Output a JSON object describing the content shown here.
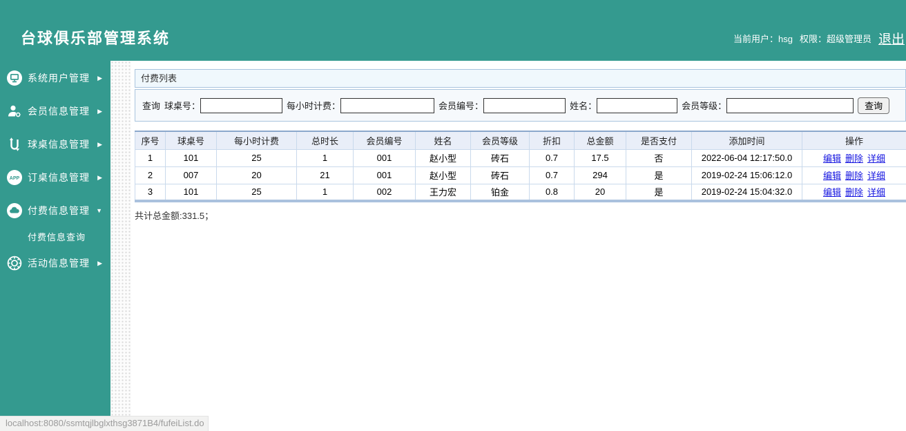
{
  "header": {
    "title": "台球俱乐部管理系统",
    "current_user": "当前用户：hsg",
    "role": "权限：超级管理员",
    "logout_label": "退出"
  },
  "sidebar": {
    "items": [
      {
        "label": "系统用户管理",
        "icon": "monitor-icon",
        "arrow": "▶"
      },
      {
        "label": "会员信息管理",
        "icon": "user-gear-icon",
        "arrow": "▶"
      },
      {
        "label": "球桌信息管理",
        "icon": "u-arrows-icon",
        "arrow": "▶"
      },
      {
        "label": "订桌信息管理",
        "icon": "app-icon",
        "arrow": "▶"
      },
      {
        "label": "付费信息管理",
        "icon": "cloud-icon",
        "arrow": "▼",
        "expanded": true
      },
      {
        "label": "活动信息管理",
        "icon": "gear-icon",
        "arrow": "▶"
      }
    ],
    "submenu": {
      "label": "付费信息查询"
    }
  },
  "main": {
    "panel_title": "付费列表",
    "search": {
      "prefix": "查询",
      "fields": [
        {
          "label": "球桌号：",
          "value": "",
          "placeholder": ""
        },
        {
          "label": "每小时计费：",
          "value": "",
          "placeholder": ""
        },
        {
          "label": "会员编号：",
          "value": "",
          "placeholder": ""
        },
        {
          "label": "姓名：",
          "value": "",
          "placeholder": ""
        },
        {
          "label": "会员等级：",
          "value": "",
          "placeholder": ""
        }
      ],
      "button_label": "查询"
    },
    "table": {
      "headers": [
        "序号",
        "球桌号",
        "每小时计费",
        "总时长",
        "会员编号",
        "姓名",
        "会员等级",
        "折扣",
        "总金额",
        "是否支付",
        "添加时间",
        "操作"
      ],
      "rows": [
        [
          "1",
          "101",
          "25",
          "1",
          "001",
          "赵小型",
          "砖石",
          "0.7",
          "17.5",
          "否",
          "2022-06-04 12:17:50.0"
        ],
        [
          "2",
          "007",
          "20",
          "21",
          "001",
          "赵小型",
          "砖石",
          "0.7",
          "294",
          "是",
          "2019-02-24 15:06:12.0"
        ],
        [
          "3",
          "101",
          "25",
          "1",
          "002",
          "王力宏",
          "铂金",
          "0.8",
          "20",
          "是",
          "2019-02-24 15:04:32.0"
        ]
      ],
      "actions": [
        "编辑",
        "删除",
        "详细"
      ]
    },
    "total_line": "共计总金额:331.5；"
  },
  "statusbar": {
    "url": "localhost:8080/ssmtqjlbglxthsg3871B4/fufeiList.do"
  },
  "colors": {
    "accent_teal": "#349a8f",
    "panel_border": "#a9c4de",
    "table_header_bg": "#e9eef8",
    "link_blue": "#1515e0"
  }
}
